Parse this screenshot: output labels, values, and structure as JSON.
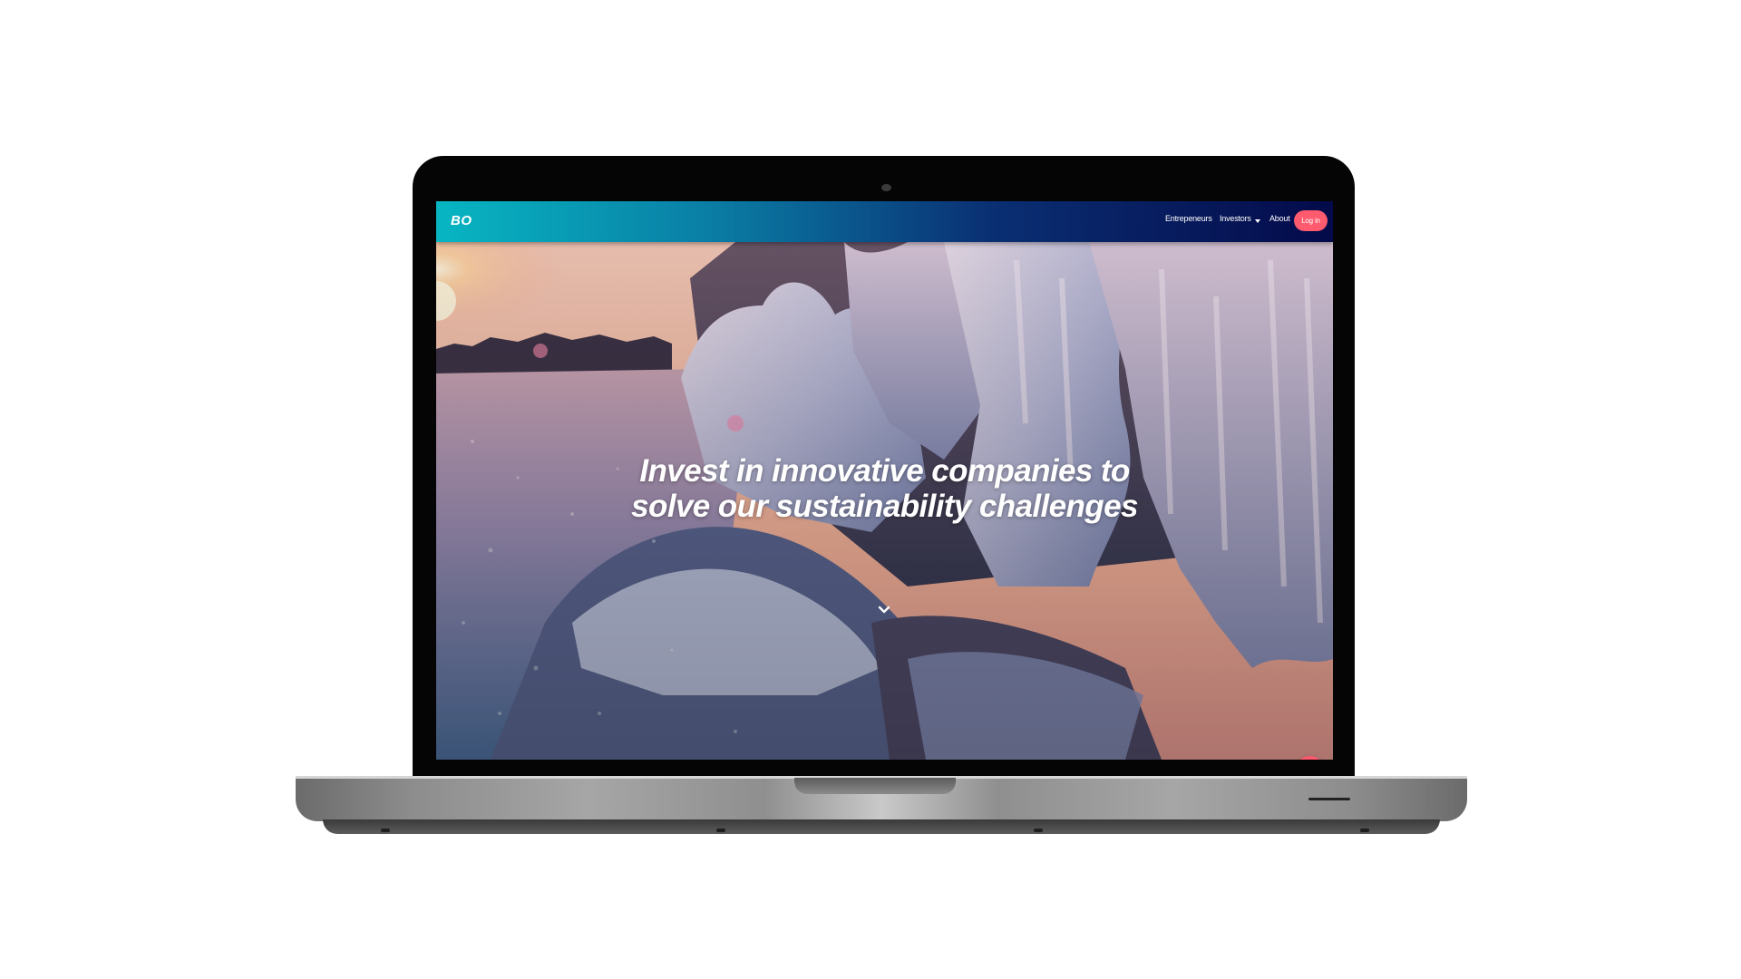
{
  "site": {
    "logo": "BO",
    "nav": {
      "entrepreneurs": "Entrepeneurs",
      "investors": "Investors",
      "about": "About",
      "login": "Log in"
    },
    "hero": {
      "headline_line1": "Invest in innovative companies to",
      "headline_line2": "solve our sustainability challenges"
    }
  },
  "icons": {
    "scroll": "chevron-down-icon",
    "chat": "chat-bubble-icon",
    "investors_caret": "caret-down-icon"
  },
  "colors": {
    "accent": "#ff5a6e",
    "nav_gradient_start": "#07b6c2",
    "nav_gradient_end": "#040a4a"
  }
}
